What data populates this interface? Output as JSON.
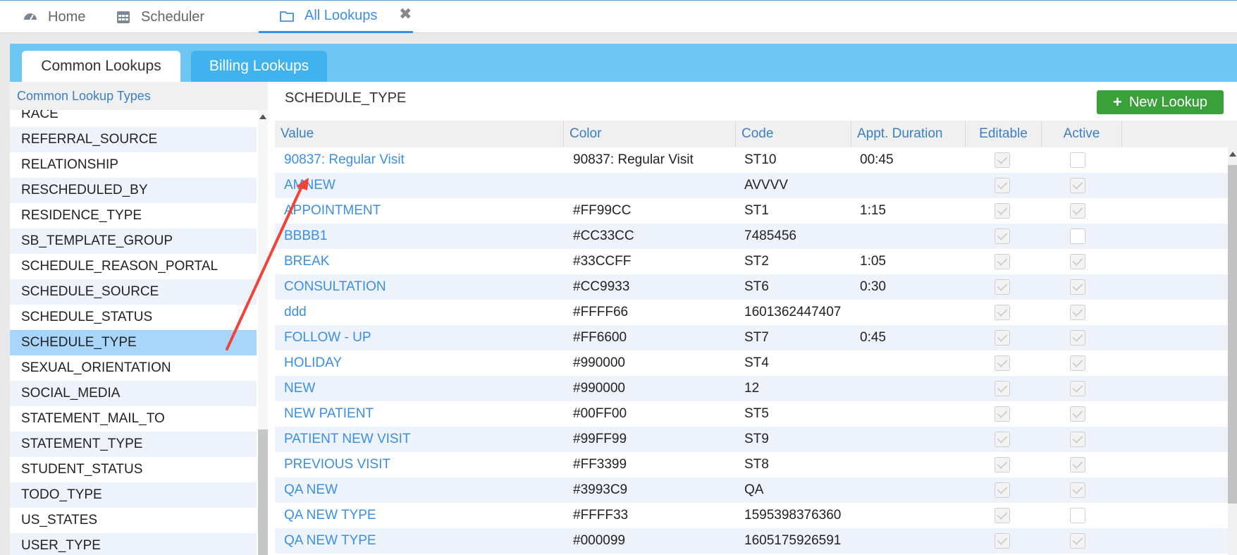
{
  "topnav": {
    "tabs": [
      {
        "label": "Home",
        "icon": "dashboard-icon"
      },
      {
        "label": "Scheduler",
        "icon": "calendar-icon"
      },
      {
        "label": "All Lookups",
        "icon": "folder-icon"
      }
    ],
    "close": "✖"
  },
  "subtabs": {
    "common": "Common Lookups",
    "billing": "Billing Lookups"
  },
  "left": {
    "header": "Common Lookup Types",
    "items": [
      "RACE",
      "REFERRAL_SOURCE",
      "RELATIONSHIP",
      "RESCHEDULED_BY",
      "RESIDENCE_TYPE",
      "SB_TEMPLATE_GROUP",
      "SCHEDULE_REASON_PORTAL",
      "SCHEDULE_SOURCE",
      "SCHEDULE_STATUS",
      "SCHEDULE_TYPE",
      "SEXUAL_ORIENTATION",
      "SOCIAL_MEDIA",
      "STATEMENT_MAIL_TO",
      "STATEMENT_TYPE",
      "STUDENT_STATUS",
      "TODO_TYPE",
      "US_STATES",
      "USER_TYPE"
    ],
    "selected": "SCHEDULE_TYPE"
  },
  "right": {
    "title": "SCHEDULE_TYPE",
    "new_button": "New Lookup",
    "columns": {
      "value": "Value",
      "color": "Color",
      "code": "Code",
      "duration": "Appt. Duration",
      "editable": "Editable",
      "active": "Active"
    },
    "rows": [
      {
        "value": "90837: Regular Visit",
        "color": "90837: Regular Visit",
        "code": "ST10",
        "duration": "00:45",
        "editable": true,
        "active": false
      },
      {
        "value": "AMNEW",
        "color": "",
        "code": "AVVVV",
        "duration": "",
        "editable": true,
        "active": true
      },
      {
        "value": "APPOINTMENT",
        "color": "#FF99CC",
        "code": "ST1",
        "duration": "1:15",
        "editable": true,
        "active": true
      },
      {
        "value": "BBBB1",
        "color": "#CC33CC",
        "code": "7485456",
        "duration": "",
        "editable": true,
        "active": false
      },
      {
        "value": "BREAK",
        "color": "#33CCFF",
        "code": "ST2",
        "duration": "1:05",
        "editable": true,
        "active": true
      },
      {
        "value": "CONSULTATION",
        "color": "#CC9933",
        "code": "ST6",
        "duration": "0:30",
        "editable": true,
        "active": true
      },
      {
        "value": "ddd",
        "color": "#FFFF66",
        "code": "1601362447407",
        "duration": "",
        "editable": true,
        "active": true
      },
      {
        "value": "FOLLOW - UP",
        "color": "#FF6600",
        "code": "ST7",
        "duration": "0:45",
        "editable": true,
        "active": true
      },
      {
        "value": "HOLIDAY",
        "color": "#990000",
        "code": "ST4",
        "duration": "",
        "editable": true,
        "active": true
      },
      {
        "value": "NEW",
        "color": "#990000",
        "code": "12",
        "duration": "",
        "editable": true,
        "active": true
      },
      {
        "value": "NEW PATIENT",
        "color": "#00FF00",
        "code": "ST5",
        "duration": "",
        "editable": true,
        "active": true
      },
      {
        "value": "PATIENT NEW VISIT",
        "color": "#99FF99",
        "code": "ST9",
        "duration": "",
        "editable": true,
        "active": true
      },
      {
        "value": "PREVIOUS VISIT",
        "color": "#FF3399",
        "code": "ST8",
        "duration": "",
        "editable": true,
        "active": true
      },
      {
        "value": "QA NEW",
        "color": "#3993C9",
        "code": "QA",
        "duration": "",
        "editable": true,
        "active": true
      },
      {
        "value": "QA NEW TYPE",
        "color": "#FFFF33",
        "code": "1595398376360",
        "duration": "",
        "editable": true,
        "active": false
      },
      {
        "value": "QA NEW TYPE",
        "color": "#000099",
        "code": "1605175926591",
        "duration": "",
        "editable": true,
        "active": true
      }
    ]
  },
  "colors": {
    "accent": "#3b8fe2",
    "tabbar": "#6ec6f2",
    "selected": "#a8d6fb",
    "button": "#3aa03a",
    "arrow": "#f0433a"
  }
}
